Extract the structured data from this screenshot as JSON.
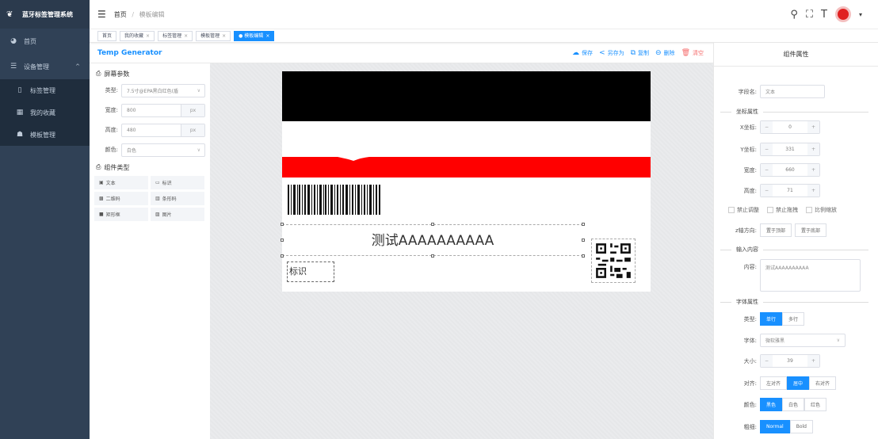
{
  "sidebar": {
    "title": "蓝牙标签管理系统",
    "items": [
      {
        "label": "首页",
        "icon": "dashboard-icon"
      },
      {
        "label": "设备管理",
        "icon": "list-icon"
      },
      {
        "label": "标签管理",
        "icon": "tag-icon"
      },
      {
        "label": "我的收藏",
        "icon": "grid-icon"
      },
      {
        "label": "模板管理",
        "icon": "template-icon"
      }
    ]
  },
  "breadcrumb": {
    "home": "首页",
    "sep": "/",
    "current": "模板编辑"
  },
  "tags": [
    {
      "label": "首页"
    },
    {
      "label": "我的收藏"
    },
    {
      "label": "标签管理"
    },
    {
      "label": "模板管理"
    },
    {
      "label": "● 模板编辑"
    }
  ],
  "tag_close": "×",
  "editor": {
    "title": "Temp Generator",
    "toolbar": {
      "save": "保存",
      "save_as": "另存为",
      "copy": "复制",
      "delete": "删除",
      "clear": "清空"
    }
  },
  "screen_params": {
    "section": "屏幕参数",
    "type_label": "类型:",
    "type_value": "7.5寸@EPA黑白红色(盾",
    "width_label": "宽度:",
    "width_value": "800",
    "height_label": "高度:",
    "height_value": "480",
    "unit": "px",
    "color_label": "颜色:",
    "color_value": "白色"
  },
  "component_types": {
    "section": "组件类型",
    "items": [
      "文本",
      "标识",
      "二维码",
      "条形码",
      "矩形框",
      "图片"
    ]
  },
  "canvas": {
    "main_text": "测试AAAAAAAAAA",
    "small_label": "标识"
  },
  "props": {
    "title": "组件属性",
    "field_name_label": "字段名:",
    "field_name_value": "文本",
    "coord_section": "坐标属性",
    "x_label": "X坐标:",
    "x_value": "0",
    "y_label": "Y坐标:",
    "y_value": "331",
    "w_label": "宽度:",
    "w_value": "660",
    "h_label": "高度:",
    "h_value": "71",
    "minus": "−",
    "plus": "+",
    "chk_resize": "禁止调整",
    "chk_drag": "禁止拖拽",
    "chk_ratio": "比例缩放",
    "z_label": "z轴方向:",
    "z_top": "置于顶部",
    "z_bottom": "置于底部",
    "input_section": "输入内容",
    "content_label": "内容:",
    "content_value": "测试AAAAAAAAAA",
    "font_section": "字体属性",
    "type_label": "类型:",
    "type_single": "单行",
    "type_multi": "多行",
    "font_label": "字体:",
    "font_value": "微软雅黑",
    "size_label": "大小:",
    "size_value": "39",
    "align_label": "对齐:",
    "align_left": "左对齐",
    "align_center": "居中",
    "align_right": "右对齐",
    "color_label": "颜色:",
    "color_black": "黑色",
    "color_white": "白色",
    "color_red": "红色",
    "weight_label": "粗细:",
    "weight_normal": "Normal",
    "weight_bold": "Bold"
  },
  "colors": {
    "accent": "#1890ff",
    "sidebar": "#304156",
    "danger": "#f56c6c",
    "label_red": "#ff0000"
  }
}
